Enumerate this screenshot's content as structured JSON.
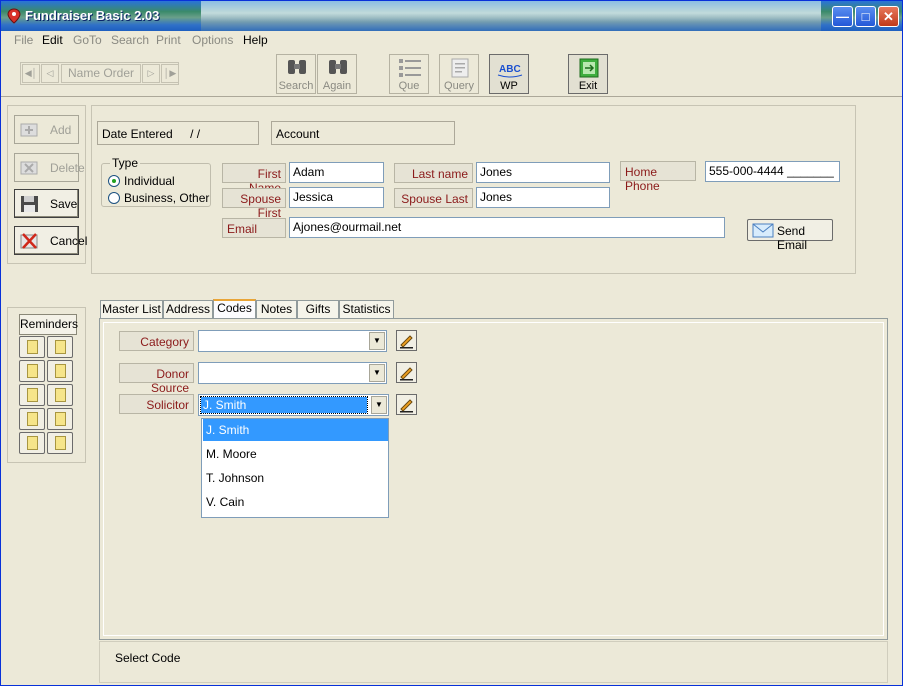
{
  "window": {
    "title": "Fundraiser Basic 2.03"
  },
  "menu": [
    {
      "label": "File",
      "enabled": false
    },
    {
      "label": "Edit",
      "enabled": true
    },
    {
      "label": "GoTo",
      "enabled": false
    },
    {
      "label": "Search",
      "enabled": false
    },
    {
      "label": "Print",
      "enabled": false
    },
    {
      "label": "Options",
      "enabled": false
    },
    {
      "label": "Help",
      "enabled": true
    }
  ],
  "toolbar": {
    "nav_label": "Name Order",
    "search": "Search",
    "again": "Again",
    "que": "Que",
    "query": "Query",
    "wp": "WP",
    "exit": "Exit"
  },
  "actions": {
    "add": "Add",
    "delete": "Delete",
    "save": "Save",
    "cancel": "Cancel"
  },
  "form": {
    "date_entered_label": "Date Entered",
    "date_entered_value": "/  /",
    "account_label": "Account",
    "type_title": "Type",
    "type_individual": "Individual",
    "type_business": "Business, Other",
    "first_name_label": "First Name",
    "first_name": "Adam",
    "last_name_label": "Last name",
    "last_name": "Jones",
    "home_phone_label": "Home Phone",
    "home_phone": "555-000-4444 _______",
    "spouse_first_label": "Spouse First",
    "spouse_first": "Jessica",
    "spouse_last_label": "Spouse Last",
    "spouse_last": "Jones",
    "email_label": "Email",
    "email": "Ajones@ourmail.net",
    "send_email": "Send Email"
  },
  "reminders": {
    "title": "Reminders"
  },
  "tabs": [
    "Master List",
    "Address",
    "Codes",
    "Notes",
    "Gifts",
    "Statistics"
  ],
  "active_tab": "Codes",
  "codes": {
    "category_label": "Category",
    "category_value": "",
    "donor_source_label": "Donor Source",
    "donor_source_value": "",
    "solicitor_label": "Solicitor",
    "solicitor_value": "J. Smith",
    "solicitor_options": [
      "J. Smith",
      "M. Moore",
      "T. Johnson",
      "V. Cain"
    ]
  },
  "status": {
    "text": "Select Code"
  }
}
